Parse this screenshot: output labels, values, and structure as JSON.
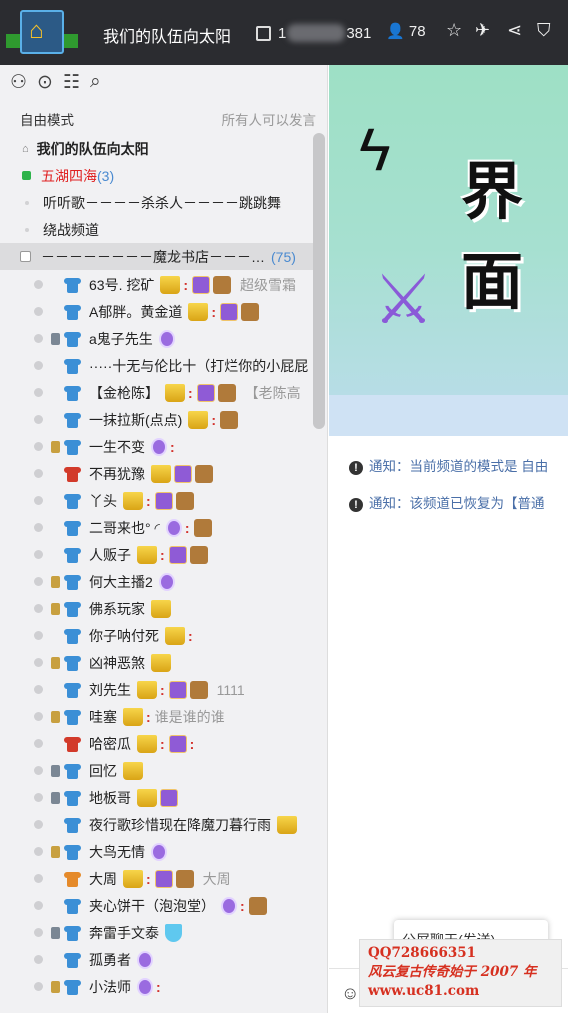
{
  "header": {
    "channel_title": "我们的队伍向太阳",
    "room_id_visible_end": "381",
    "room_id_visible_start": "1",
    "online_count": "78"
  },
  "left": {
    "mode_label": "自由模式",
    "mode_desc": "所有人可以发言",
    "channels": [
      {
        "label": "我们的队伍向太阳"
      },
      {
        "label": "五湖四海",
        "count": "(3)"
      },
      {
        "label": "听听歌－－－－杀杀人－－－－跳跳舞"
      },
      {
        "label": "绕战频道"
      },
      {
        "label": "－－－－－－－－魔龙书店－－－…",
        "count": "(75)"
      }
    ],
    "users": [
      {
        "name": "63号. 挖矿",
        "note": "超级雪霜"
      },
      {
        "name": "A郁胖。黄金道"
      },
      {
        "name": "a鬼子先生"
      },
      {
        "name": "·····十无与伦比十（打烂你的小屁屁"
      },
      {
        "name": "【金枪陈】",
        "note": "【老陈高"
      },
      {
        "name": "一抹拉斯(点点)"
      },
      {
        "name": "一生不变"
      },
      {
        "name": "不再犹豫"
      },
      {
        "name": "丫头"
      },
      {
        "name": "二哥来也° ◜"
      },
      {
        "name": "人贩子"
      },
      {
        "name": "何大主播2"
      },
      {
        "name": "佛系玩家"
      },
      {
        "name": "你子呐付死"
      },
      {
        "name": "凶神恶煞"
      },
      {
        "name": "刘先生",
        "note": "1111"
      },
      {
        "name": "哇塞",
        "note": "谁是谁的谁"
      },
      {
        "name": "哈密瓜"
      },
      {
        "name": "回忆"
      },
      {
        "name": "地板哥"
      },
      {
        "name": "夜行歌珍惜现在降魔刀暮行雨"
      },
      {
        "name": "大鸟无情"
      },
      {
        "name": "大周",
        "note": "大周"
      },
      {
        "name": "夹心饼干（泡泡堂）"
      },
      {
        "name": "奔雷手文泰"
      },
      {
        "name": "孤勇者"
      },
      {
        "name": "小法师"
      }
    ]
  },
  "right": {
    "banner_text": "界面",
    "notices": [
      {
        "prefix": "通知：",
        "text": "当前频道的模式是 自由"
      },
      {
        "prefix": "通知：",
        "text": "该频道已恢复为【普通"
      }
    ],
    "popup_text": "公屏聊天(发送)"
  },
  "watermark": {
    "line1": "QQ728666351",
    "line2": "风云复古传奇始于 2007 年",
    "line3": "www.uc81.com"
  }
}
